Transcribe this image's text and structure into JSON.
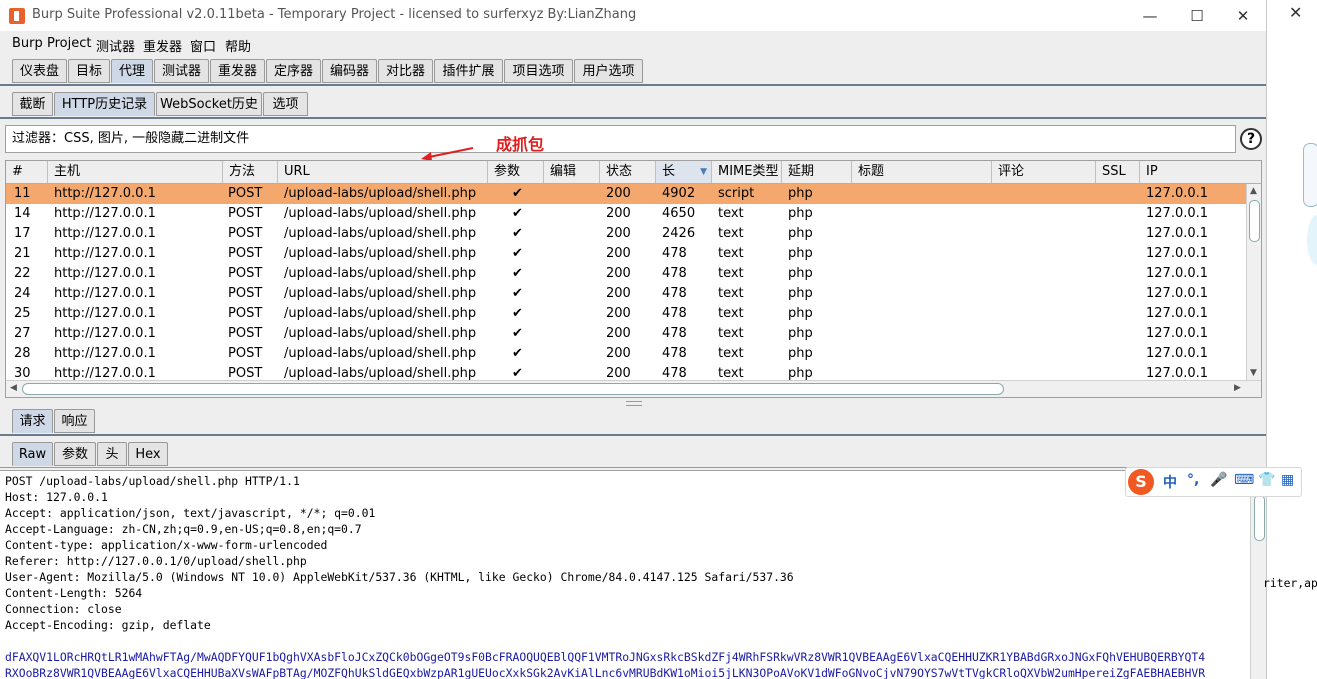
{
  "window": {
    "title": "Burp Suite Professional v2.0.11beta - Temporary Project - licensed to surferxyz By:LianZhang",
    "minimize": "—",
    "maximize": "☐",
    "close": "✕"
  },
  "menu": [
    "Burp",
    "Project",
    "测试器",
    "重发器",
    "窗口",
    "帮助"
  ],
  "main_tabs": [
    "仪表盘",
    "目标",
    "代理",
    "测试器",
    "重发器",
    "定序器",
    "编码器",
    "对比器",
    "插件扩展",
    "项目选项",
    "用户选项"
  ],
  "main_tabs_selected": "代理",
  "proxy_tabs": [
    "截断",
    "HTTP历史记录",
    "WebSocket历史",
    "选项"
  ],
  "proxy_tabs_selected": "HTTP历史记录",
  "filter": {
    "text": "过滤器：CSS, 图片, 一般隐藏二进制文件",
    "help": "?"
  },
  "annotation": "成抓包",
  "table": {
    "columns": [
      "#",
      "主机",
      "方法",
      "URL",
      "参数",
      "编辑",
      "状态",
      "长",
      "MIME类型",
      "延期",
      "标题",
      "评论",
      "SSL",
      "IP"
    ],
    "sorted_column": "长",
    "rows": [
      {
        "num": "11",
        "host": "http://127.0.0.1",
        "method": "POST",
        "url": "/upload-labs/upload/shell.php",
        "params": "✔",
        "edited": "",
        "status": "200",
        "length": "4902",
        "mime": "script",
        "ext": "php",
        "title": "",
        "comment": "",
        "ssl": "",
        "ip": "127.0.0.1",
        "selected": true
      },
      {
        "num": "14",
        "host": "http://127.0.0.1",
        "method": "POST",
        "url": "/upload-labs/upload/shell.php",
        "params": "✔",
        "edited": "",
        "status": "200",
        "length": "4650",
        "mime": "text",
        "ext": "php",
        "title": "",
        "comment": "",
        "ssl": "",
        "ip": "127.0.0.1"
      },
      {
        "num": "17",
        "host": "http://127.0.0.1",
        "method": "POST",
        "url": "/upload-labs/upload/shell.php",
        "params": "✔",
        "edited": "",
        "status": "200",
        "length": "2426",
        "mime": "text",
        "ext": "php",
        "title": "",
        "comment": "",
        "ssl": "",
        "ip": "127.0.0.1"
      },
      {
        "num": "21",
        "host": "http://127.0.0.1",
        "method": "POST",
        "url": "/upload-labs/upload/shell.php",
        "params": "✔",
        "edited": "",
        "status": "200",
        "length": "478",
        "mime": "text",
        "ext": "php",
        "title": "",
        "comment": "",
        "ssl": "",
        "ip": "127.0.0.1"
      },
      {
        "num": "22",
        "host": "http://127.0.0.1",
        "method": "POST",
        "url": "/upload-labs/upload/shell.php",
        "params": "✔",
        "edited": "",
        "status": "200",
        "length": "478",
        "mime": "text",
        "ext": "php",
        "title": "",
        "comment": "",
        "ssl": "",
        "ip": "127.0.0.1"
      },
      {
        "num": "24",
        "host": "http://127.0.0.1",
        "method": "POST",
        "url": "/upload-labs/upload/shell.php",
        "params": "✔",
        "edited": "",
        "status": "200",
        "length": "478",
        "mime": "text",
        "ext": "php",
        "title": "",
        "comment": "",
        "ssl": "",
        "ip": "127.0.0.1"
      },
      {
        "num": "25",
        "host": "http://127.0.0.1",
        "method": "POST",
        "url": "/upload-labs/upload/shell.php",
        "params": "✔",
        "edited": "",
        "status": "200",
        "length": "478",
        "mime": "text",
        "ext": "php",
        "title": "",
        "comment": "",
        "ssl": "",
        "ip": "127.0.0.1"
      },
      {
        "num": "27",
        "host": "http://127.0.0.1",
        "method": "POST",
        "url": "/upload-labs/upload/shell.php",
        "params": "✔",
        "edited": "",
        "status": "200",
        "length": "478",
        "mime": "text",
        "ext": "php",
        "title": "",
        "comment": "",
        "ssl": "",
        "ip": "127.0.0.1"
      },
      {
        "num": "28",
        "host": "http://127.0.0.1",
        "method": "POST",
        "url": "/upload-labs/upload/shell.php",
        "params": "✔",
        "edited": "",
        "status": "200",
        "length": "478",
        "mime": "text",
        "ext": "php",
        "title": "",
        "comment": "",
        "ssl": "",
        "ip": "127.0.0.1"
      },
      {
        "num": "30",
        "host": "http://127.0.0.1",
        "method": "POST",
        "url": "/upload-labs/upload/shell.php",
        "params": "✔",
        "edited": "",
        "status": "200",
        "length": "478",
        "mime": "text",
        "ext": "php",
        "title": "",
        "comment": "",
        "ssl": "",
        "ip": "127.0.0.1"
      }
    ]
  },
  "req_resp_tabs": [
    "请求",
    "响应"
  ],
  "req_resp_selected": "请求",
  "view_tabs": [
    "Raw",
    "参数",
    "头",
    "Hex"
  ],
  "view_tabs_selected": "Raw",
  "request_lines": [
    "POST /upload-labs/upload/shell.php HTTP/1.1",
    "Host: 127.0.0.1",
    "Accept: application/json, text/javascript, */*; q=0.01",
    "Accept-Language: zh-CN,zh;q=0.9,en-US;q=0.8,en;q=0.7",
    "Content-type: application/x-www-form-urlencoded",
    "Referer: http://127.0.0.1/0/upload/shell.php",
    "User-Agent: Mozilla/5.0 (Windows NT 10.0) AppleWebKit/537.36 (KHTML, like Gecko) Chrome/84.0.4147.125 Safari/537.36",
    "Content-Length: 5264",
    "Connection: close",
    "Accept-Encoding: gzip, deflate"
  ],
  "request_body_lines": [
    "dFAXQV1LORcHRQtLR1wMAhwFTAg/MwAQDFYQUF1bQghVXAsbFloJCxZQCk0bOGgeOT9sF0BcFRAOQUQEBlQQF1VMTRoJNGxsRkcBSkdZFj4WRhFSRkwVRz8VWR1QVBEAAgE6VlxaCQEHHUZKR1YBABdGRxoJNGxFQhVEHUBQERBYQT4",
    "RXOoBRz8VWR1QVBEAAgE6VlxaCQEHHUBaXVsWAFpBTAg/MOZFQhUkSldGEQxbWzpAR1gUEUocXxkSGk2AvKiAlLnc6vMRUBdKW1oMioi5jLKN3OPoAVoKV1dWFoGNvoCjvN79OYS7wVtTVgkCRloQXVbW2umHpereiZgFAEBHAEBHVR"
  ],
  "ime": {
    "logo": "S",
    "items": [
      "中",
      "°,",
      "🎤",
      "⌨",
      "👕",
      "▦"
    ]
  },
  "desktop_side_text": "riter,ap"
}
